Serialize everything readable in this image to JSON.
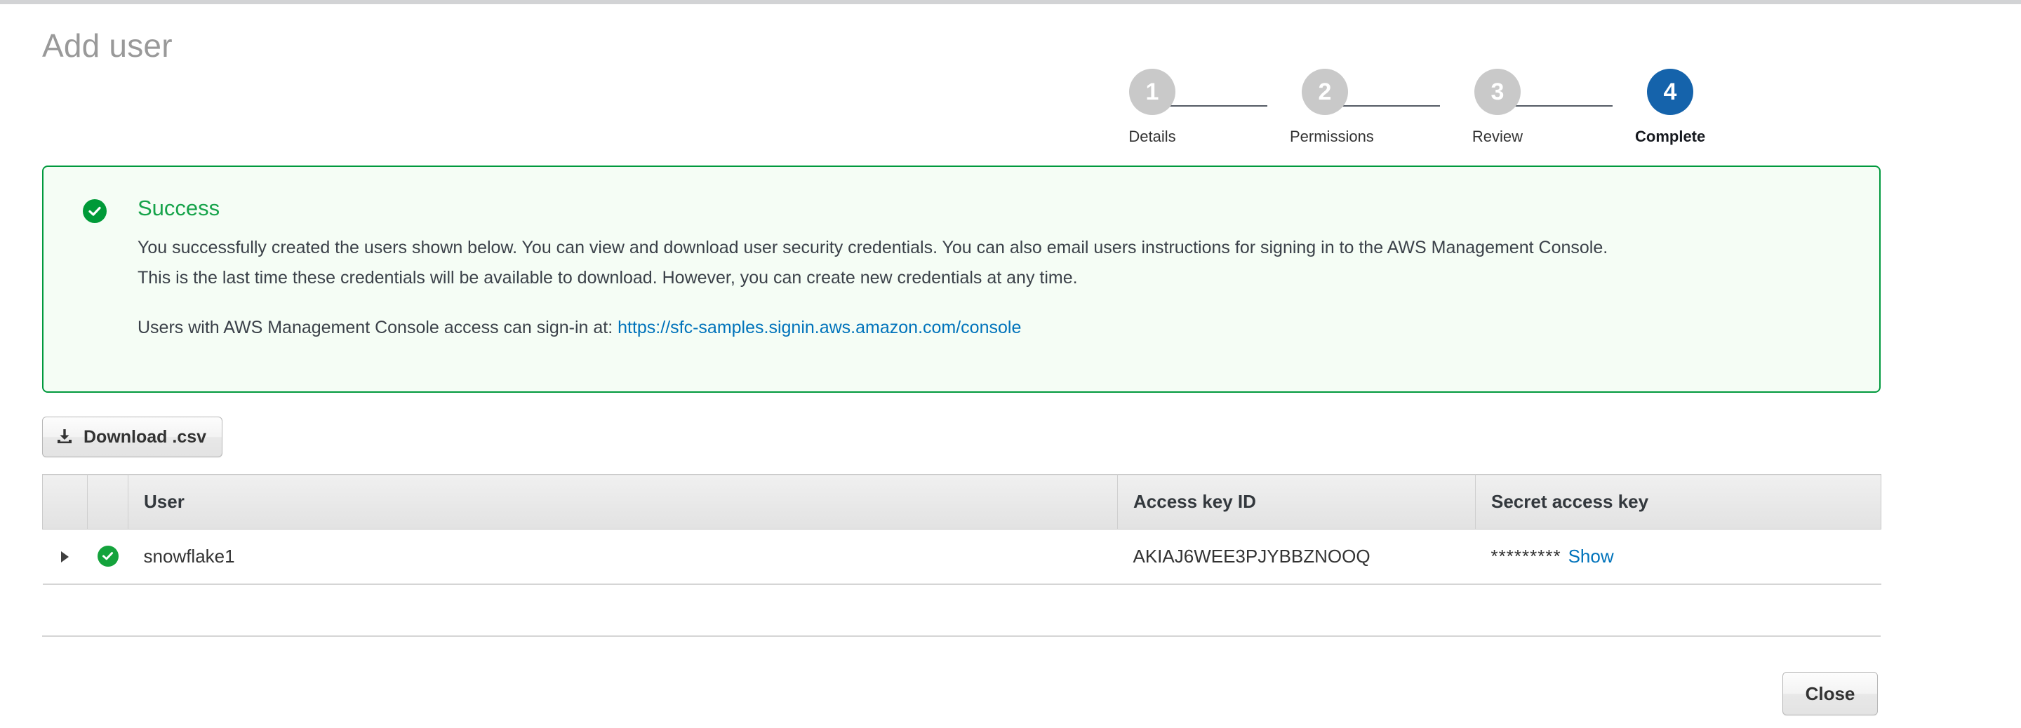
{
  "window": {
    "title": "Add user"
  },
  "wizard": {
    "steps": [
      {
        "number": "1",
        "label": "Details",
        "state": "done"
      },
      {
        "number": "2",
        "label": "Permissions",
        "state": "done"
      },
      {
        "number": "3",
        "label": "Review",
        "state": "done"
      },
      {
        "number": "4",
        "label": "Complete",
        "state": "active"
      }
    ],
    "active_color": "#1563ab",
    "inactive_color": "#c9c9c9"
  },
  "alert": {
    "type": "success",
    "icon": "check-circle-icon",
    "title": "Success",
    "border_color": "#00993d",
    "background_color": "#f5fdf5",
    "body_line1": "You successfully created the users shown below. You can view and download user security credentials. You can also email users instructions for signing in to the AWS Management Console.",
    "body_line2": "This is the last time these credentials will be available to download. However, you can create new credentials at any time.",
    "signin_prefix": "Users with AWS Management Console access can sign-in at:",
    "signin_url": "https://sfc-samples.signin.aws.amazon.com/console",
    "link_color": "#0073bb"
  },
  "toolbar": {
    "download_label": "Download .csv",
    "download_icon": "download-icon"
  },
  "table": {
    "headers": {
      "expand": "",
      "status": "",
      "user": "User",
      "access_key_id": "Access key ID",
      "secret_access_key": "Secret access key"
    },
    "rows": [
      {
        "expand_icon": "caret-right-icon",
        "status_icon": "check-circle-icon",
        "user": "snowflake1",
        "access_key_id": "AKIAJ6WEE3PJYBBZNOOQ",
        "secret_masked": "*********",
        "secret_show_label": "Show"
      }
    ]
  },
  "footer": {
    "close_label": "Close"
  }
}
